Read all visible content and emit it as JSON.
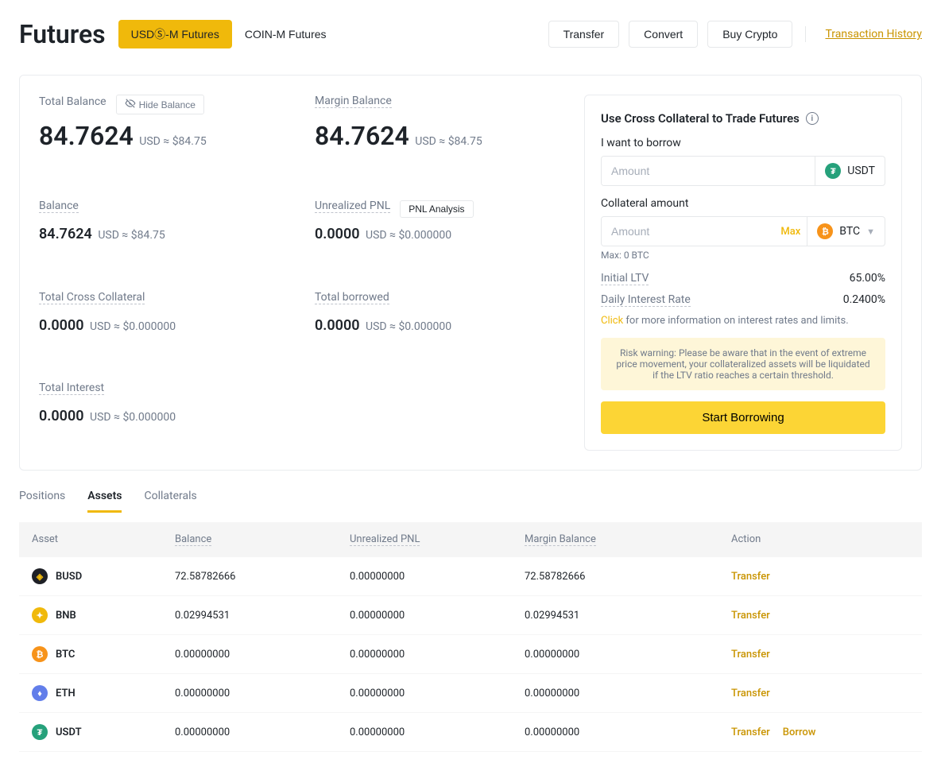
{
  "header": {
    "title": "Futures",
    "tabs": [
      "USDⓈ-M Futures",
      "COIN-M Futures"
    ],
    "buttons": {
      "transfer": "Transfer",
      "convert": "Convert",
      "buy": "Buy Crypto"
    },
    "history_link": "Transaction History"
  },
  "stats": {
    "total_balance_label": "Total Balance",
    "hide_balance": "Hide Balance",
    "total_balance_value": "84.7624",
    "total_balance_unit": "USD",
    "total_balance_approx": "≈ $84.75",
    "margin_balance_label": "Margin Balance",
    "margin_balance_value": "84.7624",
    "margin_balance_unit": "USD",
    "margin_balance_approx": "≈ $84.75",
    "balance_label": "Balance",
    "balance_value": "84.7624",
    "balance_unit": "USD",
    "balance_approx": "≈ $84.75",
    "unrealized_pnl_label": "Unrealized PNL",
    "pnl_analysis": "PNL Analysis",
    "unrealized_pnl_value": "0.0000",
    "unrealized_pnl_unit": "USD",
    "unrealized_pnl_approx": "≈ $0.000000",
    "total_cross_label": "Total Cross Collateral",
    "total_cross_value": "0.0000",
    "total_cross_unit": "USD",
    "total_cross_approx": "≈ $0.000000",
    "total_borrowed_label": "Total borrowed",
    "total_borrowed_value": "0.0000",
    "total_borrowed_unit": "USD",
    "total_borrowed_approx": "≈ $0.000000",
    "total_interest_label": "Total Interest",
    "total_interest_value": "0.0000",
    "total_interest_unit": "USD",
    "total_interest_approx": "≈ $0.000000"
  },
  "borrow": {
    "title": "Use Cross Collateral to Trade Futures",
    "want_label": "I want to borrow",
    "amount_placeholder": "Amount",
    "borrow_currency": "USDT",
    "collateral_label": "Collateral amount",
    "max_label": "Max",
    "collateral_currency": "BTC",
    "max_note": "Max: 0 BTC",
    "ltv_label": "Initial LTV",
    "ltv_value": "65.00%",
    "rate_label": "Daily Interest Rate",
    "rate_value": "0.2400%",
    "click": "Click",
    "info_text": " for more information on interest rates and limits.",
    "warning": "Risk warning: Please be aware that in the event of extreme price movement, your collateralized assets will be liquidated if the LTV ratio reaches a certain threshold.",
    "start": "Start Borrowing"
  },
  "tabs2": [
    "Positions",
    "Assets",
    "Collaterals"
  ],
  "table": {
    "headers": {
      "asset": "Asset",
      "balance": "Balance",
      "pnl": "Unrealized PNL",
      "margin": "Margin Balance",
      "action": "Action"
    },
    "rows": [
      {
        "asset": "BUSD",
        "icon": "busd",
        "balance": "72.58782666",
        "pnl": "0.00000000",
        "margin": "72.58782666",
        "actions": [
          "Transfer"
        ]
      },
      {
        "asset": "BNB",
        "icon": "bnb",
        "balance": "0.02994531",
        "pnl": "0.00000000",
        "margin": "0.02994531",
        "actions": [
          "Transfer"
        ]
      },
      {
        "asset": "BTC",
        "icon": "btc",
        "balance": "0.00000000",
        "pnl": "0.00000000",
        "margin": "0.00000000",
        "actions": [
          "Transfer"
        ]
      },
      {
        "asset": "ETH",
        "icon": "eth",
        "balance": "0.00000000",
        "pnl": "0.00000000",
        "margin": "0.00000000",
        "actions": [
          "Transfer"
        ]
      },
      {
        "asset": "USDT",
        "icon": "usdt",
        "balance": "0.00000000",
        "pnl": "0.00000000",
        "margin": "0.00000000",
        "actions": [
          "Transfer",
          "Borrow"
        ]
      }
    ]
  }
}
